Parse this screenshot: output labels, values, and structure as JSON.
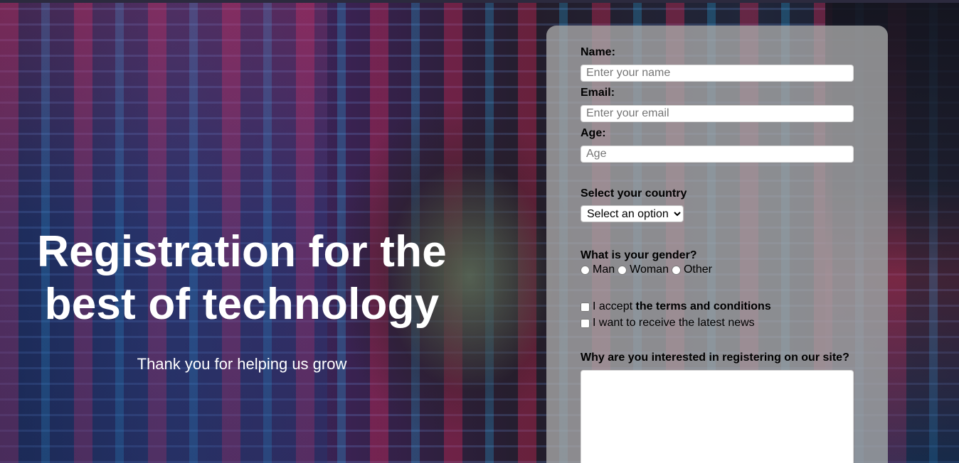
{
  "hero": {
    "title_line1": "Registration for the",
    "title_line2": "best of technology",
    "subtitle": "Thank you for helping us grow"
  },
  "form": {
    "name_label": "Name:",
    "name_placeholder": "Enter your name",
    "email_label": "Email:",
    "email_placeholder": "Enter your email",
    "age_label": "Age:",
    "age_placeholder": "Age",
    "country_label": "Select your country",
    "country_selected": "Select an option",
    "gender_label": "What is your gender?",
    "gender_options": [
      "Man",
      "Woman",
      "Other"
    ],
    "terms_prefix": "I accept ",
    "terms_bold": "the terms and conditions",
    "news_label": "I want to receive the latest news",
    "reason_label": "Why are you interested in registering on our site?"
  },
  "colors": {
    "card": "#aaaaaa",
    "title_text": "#ffffff"
  }
}
